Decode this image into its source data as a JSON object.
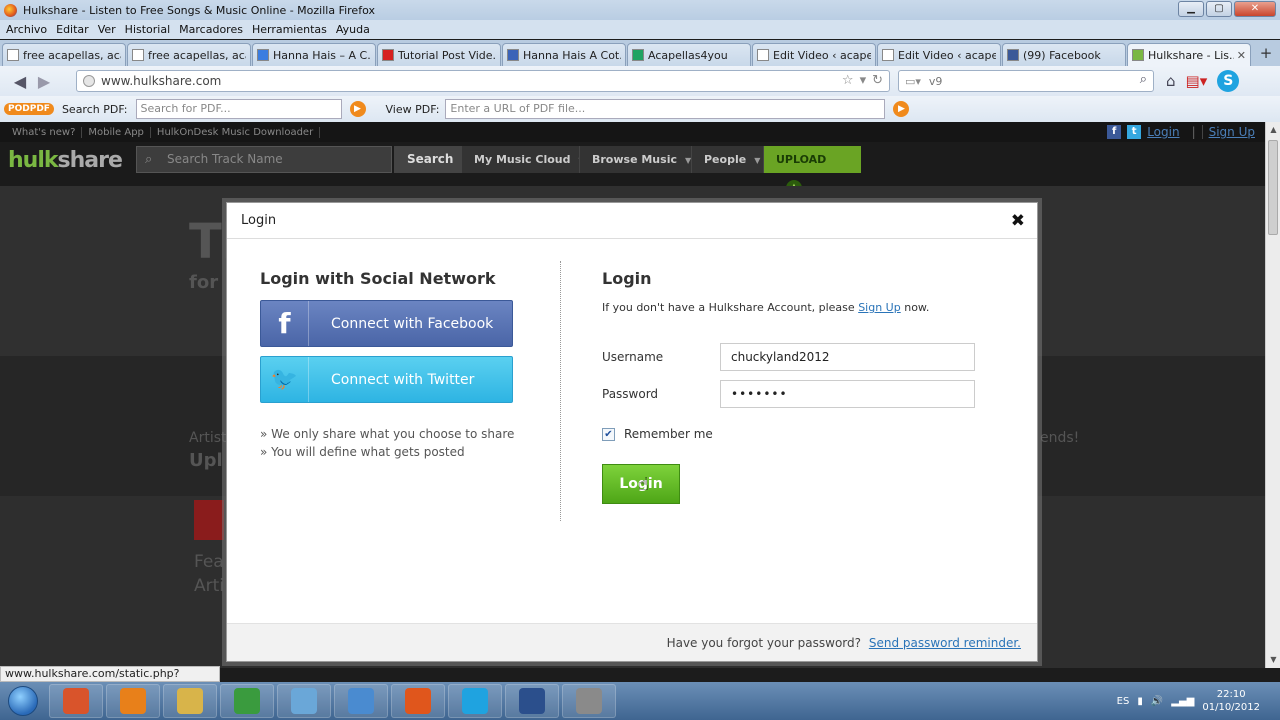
{
  "window": {
    "title": "Hulkshare - Listen to Free Songs & Music Online - Mozilla Firefox",
    "minimize": "▁",
    "maximize": "▢",
    "close": "✕"
  },
  "menu": [
    "Archivo",
    "Editar",
    "Ver",
    "Historial",
    "Marcadores",
    "Herramientas",
    "Ayuda"
  ],
  "tabs": [
    {
      "label": "free acapellas, aca...",
      "icon": "page-icon",
      "color": "#ffffff"
    },
    {
      "label": "free acapellas, aca...",
      "icon": "page-icon",
      "color": "#ffffff"
    },
    {
      "label": "Hanna Hais – A C...",
      "icon": "google-icon",
      "color": "#3b7de0"
    },
    {
      "label": "Tutorial Post Vide...",
      "icon": "youtube-icon",
      "color": "#d62020"
    },
    {
      "label": "Hanna Hais A Cot...",
      "icon": "r-icon",
      "color": "#3b63b8"
    },
    {
      "label": "Acapellas4you",
      "icon": "sheet-icon",
      "color": "#1ea362"
    },
    {
      "label": "Edit Video ‹ acapel...",
      "icon": "page-icon",
      "color": "#ffffff"
    },
    {
      "label": "Edit Video ‹ acapel...",
      "icon": "page-icon",
      "color": "#ffffff"
    },
    {
      "label": "(99) Facebook",
      "icon": "facebook-icon",
      "color": "#3b5998"
    },
    {
      "label": "Hulkshare - Lis...",
      "icon": "hulkshare-icon",
      "color": "#7ab742",
      "active": true
    }
  ],
  "tab_new": "+",
  "nav": {
    "url": "www.hulkshare.com",
    "search_value": "v9",
    "back": "◀",
    "forward": "▶"
  },
  "pdfbar": {
    "logo": "PDF",
    "search_label": "Search PDF:",
    "search_placeholder": "Search for PDF...",
    "view_label": "View PDF:",
    "view_placeholder": "Enter a URL of PDF file..."
  },
  "site": {
    "top_links": [
      "What's new?",
      "Mobile App",
      "HulkOnDesk Music Downloader"
    ],
    "login_link": "Login",
    "signup_link": "Sign Up",
    "logo_a": "hulk",
    "logo_b": "share",
    "search_placeholder": "Search Track Name",
    "search_button": "Search",
    "nav": [
      "My Music Cloud",
      "Browse Music",
      "People"
    ],
    "upload": "UPLOAD",
    "hero_big": "Th",
    "hero_sub": "for",
    "artist": "Artist",
    "upl": "Upl",
    "ends": "ends!",
    "fea": "Fea",
    "arti": "Arti"
  },
  "modal": {
    "title": "Login",
    "close": "✖",
    "social_title": "Login with Social Network",
    "facebook_label": "Connect with Facebook",
    "twitter_label": "Connect with Twitter",
    "notes": [
      "» We only share what you choose to share",
      "» You will define what gets posted"
    ],
    "login_title": "Login",
    "intro_a": "If you don't have a Hulkshare Account, please",
    "intro_link": "Sign Up",
    "intro_b": "now.",
    "username_label": "Username",
    "username_value": "chuckyland2012",
    "password_label": "Password",
    "password_value": "•••••••",
    "remember_label": "Remember me",
    "remember_checked": true,
    "login_button": "Login",
    "forgot_text": "Have you forgot your password?",
    "forgot_link": "Send password reminder."
  },
  "statusbar": "www.hulkshare.com/static.php?op=login#",
  "taskbar": {
    "items": [
      {
        "name": "installer-icon",
        "color": "#d9542b"
      },
      {
        "name": "media-player-icon",
        "color": "#e8801a"
      },
      {
        "name": "explorer-icon",
        "color": "#d8b44a"
      },
      {
        "name": "chrome-icon",
        "color": "#3a9b3e"
      },
      {
        "name": "app-icon",
        "color": "#6aa7d8"
      },
      {
        "name": "network-icon",
        "color": "#4a8bd0"
      },
      {
        "name": "firefox-icon",
        "color": "#e0561c"
      },
      {
        "name": "skype-icon",
        "color": "#1fa3e0"
      },
      {
        "name": "floppy-icon",
        "color": "#2b4f8c"
      },
      {
        "name": "magnifier-icon",
        "color": "#8a8a8a"
      }
    ],
    "lang": "ES",
    "time": "22:10",
    "date": "01/10/2012"
  }
}
